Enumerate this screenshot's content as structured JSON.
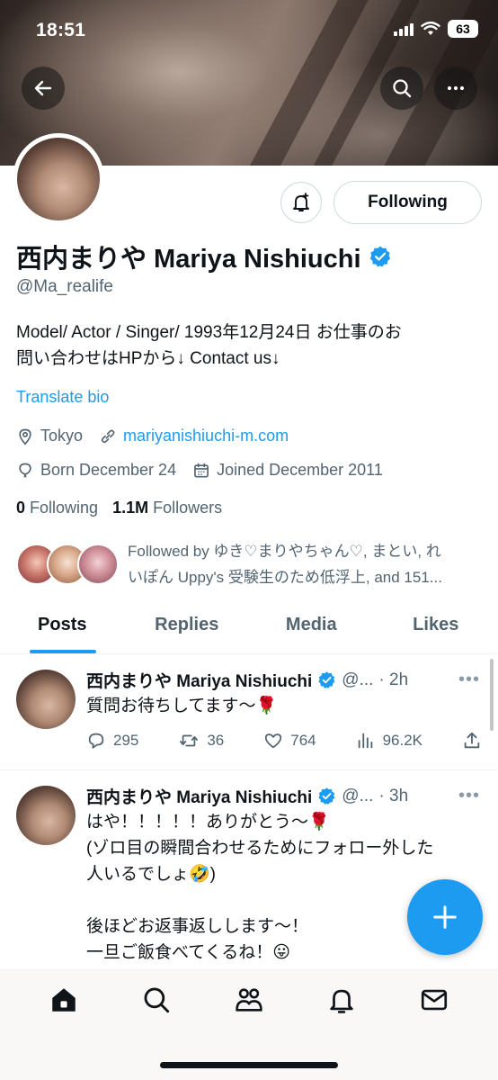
{
  "status_bar": {
    "time": "18:51",
    "battery": "63"
  },
  "profile": {
    "name": "西内まりや Mariya Nishiuchi",
    "handle": "@Ma_realife",
    "bio_line1": "Model/ Actor / Singer/ 1993年12月24日 お仕事のお",
    "bio_line2": "問い合わせはHPから↓ Contact us↓",
    "translate_bio": "Translate bio",
    "location": "Tokyo",
    "website": "mariyanishiuchi-m.com",
    "born": "Born December 24",
    "joined": "Joined December 2011",
    "following_count": "0",
    "following_label": "Following",
    "followers_count": "1.1M",
    "followers_label": "Followers",
    "followed_by_line1": "Followed by ゆき♡まりやちゃん♡, まとい, れ",
    "followed_by_line2": "いぽん Uppy's 受験生のため低浮上, and 151...",
    "following_button": "Following"
  },
  "tabs": [
    {
      "label": "Posts"
    },
    {
      "label": "Replies"
    },
    {
      "label": "Media"
    },
    {
      "label": "Likes"
    }
  ],
  "tweets": [
    {
      "name": "西内まりや Mariya Nishiuchi",
      "handle": "@...",
      "time": "· 2h",
      "text": "質問お待ちしてます〜🌹",
      "replies": "295",
      "retweets": "36",
      "likes": "764",
      "views": "96.2K"
    },
    {
      "name": "西内まりや Mariya Nishiuchi",
      "handle": "@...",
      "time": "· 3h",
      "text": "はや！！！！！ありがとう〜🌹\n(ゾロ目の瞬間合わせるためにフォロー外した\n人いるでしょ🤣)\n\n後ほどお返事返しします〜！\n一旦ご飯食べてくるね！😛"
    }
  ],
  "more_glyph": "•••",
  "colors": {
    "accent": "#1d9bf0",
    "text": "#0f1419",
    "secondary": "#536471"
  },
  "icons": [
    "back-arrow-icon",
    "search-icon",
    "more-icon",
    "bell-plus-icon",
    "verified-icon",
    "location-icon",
    "link-icon",
    "balloon-icon",
    "calendar-icon",
    "reply-icon",
    "retweet-icon",
    "like-icon",
    "views-icon",
    "share-icon",
    "plus-icon",
    "home-icon",
    "communities-icon",
    "notifications-icon",
    "messages-icon"
  ]
}
